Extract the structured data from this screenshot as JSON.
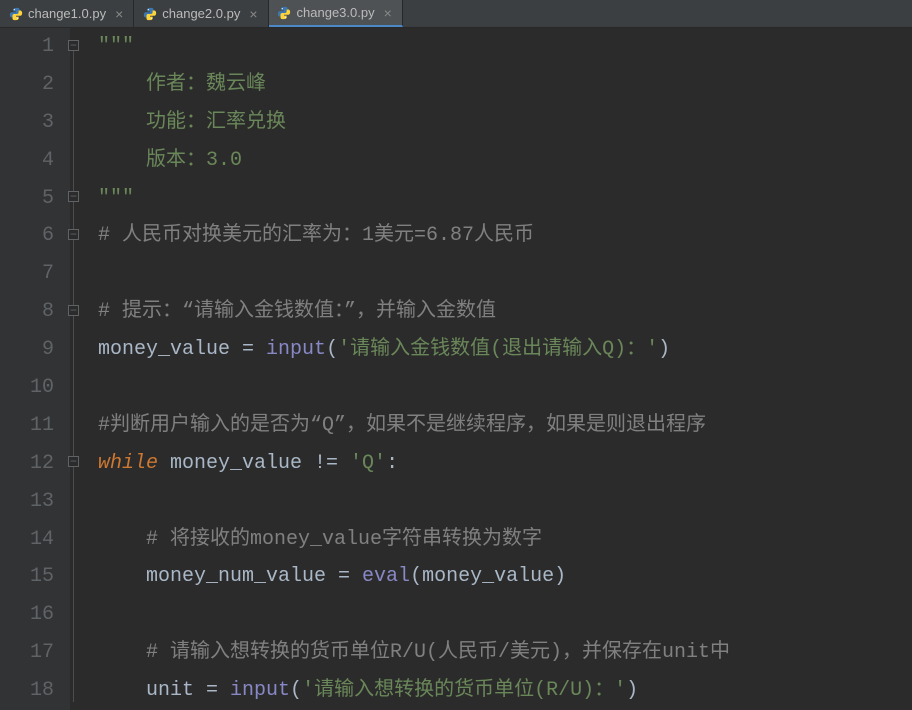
{
  "tabs": [
    {
      "label": "change1.0.py",
      "active": false
    },
    {
      "label": "change2.0.py",
      "active": false
    },
    {
      "label": "change3.0.py",
      "active": true
    }
  ],
  "gutter": {
    "1": "1",
    "2": "2",
    "3": "3",
    "4": "4",
    "5": "5",
    "6": "6",
    "7": "7",
    "8": "8",
    "9": "9",
    "10": "10",
    "11": "11",
    "12": "12",
    "13": "13",
    "14": "14",
    "15": "15",
    "16": "16",
    "17": "17",
    "18": "18"
  },
  "code": {
    "l1": "\"\"\"",
    "l2": "    作者：魏云峰",
    "l3": "    功能：汇率兑换",
    "l4": "    版本：3.0",
    "l5": "\"\"\"",
    "l6": "# 人民币对换美元的汇率为：1美元=6.87人民币",
    "l8": "# 提示：“请输入金钱数值：”，并输入金数值",
    "l9a": "money_value ",
    "l9b": "= ",
    "l9c": "input",
    "l9d": "(",
    "l9e": "'请输入金钱数值(退出请输入Q)：'",
    "l9f": ")",
    "l11": "#判断用户输入的是否为“Q”，如果不是继续程序，如果是则退出程序",
    "l12a": "while",
    "l12b": " money_value != ",
    "l12c": "'Q'",
    "l12d": ":",
    "l14": "    # 将接收的money_value字符串转换为数字",
    "l15a": "    money_num_value = ",
    "l15b": "eval",
    "l15c": "(money_value)",
    "l17": "    # 请输入想转换的货币单位R/U(人民币/美元)，并保存在unit中",
    "l18a": "    unit = ",
    "l18b": "input",
    "l18c": "(",
    "l18d": "'请输入想转换的货币单位(R/U)：'",
    "l18e": ")"
  }
}
